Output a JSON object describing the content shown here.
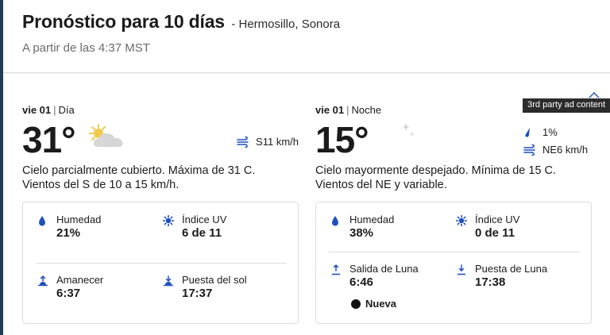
{
  "header": {
    "title": "Pronóstico para 10 días",
    "location": "- Hermosillo, Sonora",
    "as_of": "A partir de las 4:37 MST"
  },
  "ad_tag": "3rd party ad content",
  "day": {
    "weekday": "vie 01",
    "separator": "|",
    "period_label": "Día",
    "temp": "31°",
    "condition_icon": "partly-cloudy-icon",
    "wind": "S11 km/h",
    "narrative": "Cielo parcialmente cubierto. Máxima de 31 C. Vientos del S de 10 a 15 km/h.",
    "humidity_label": "Humedad",
    "humidity_value": "21%",
    "uv_label": "Índice UV",
    "uv_value": "6 de 11",
    "sunrise_label": "Amanecer",
    "sunrise_value": "6:37",
    "sunset_label": "Puesta del sol",
    "sunset_value": "17:37"
  },
  "night": {
    "weekday": "vie 01",
    "separator": "|",
    "period_label": "Noche",
    "temp": "15°",
    "condition_icon": "moon-stars-icon",
    "precip": "1%",
    "wind": "NE6 km/h",
    "narrative": "Cielo mayormente despejado. Mínima de 15 C. Vientos del NE y variable.",
    "humidity_label": "Humedad",
    "humidity_value": "38%",
    "uv_label": "Índice UV",
    "uv_value": "0 de 11",
    "moonrise_label": "Salida de Luna",
    "moonrise_value": "6:46",
    "moonset_label": "Puesta de Luna",
    "moonset_value": "17:38",
    "moon_phase": "Nueva"
  },
  "colors": {
    "icon_blue": "#1f4fbf",
    "sun_yellow": "#f2c94c",
    "cloud_gray": "#d6d6d6"
  }
}
